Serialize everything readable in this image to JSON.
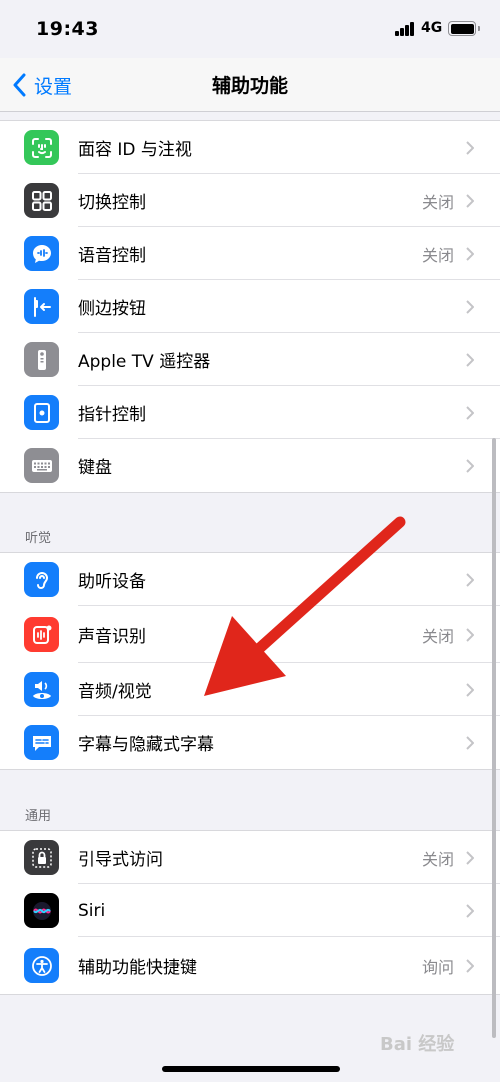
{
  "status_bar": {
    "time": "19:43",
    "network": "4G"
  },
  "nav": {
    "back_label": "设置",
    "title": "辅助功能"
  },
  "group_top": [
    {
      "name": "face-id",
      "label": "面容 ID 与注视",
      "value": "",
      "icon": "face-id-icon",
      "color": "#34c759"
    },
    {
      "name": "switch-control",
      "label": "切换控制",
      "value": "关闭",
      "icon": "switch-control-icon",
      "color": "#3a3a3c"
    },
    {
      "name": "voice-control",
      "label": "语音控制",
      "value": "关闭",
      "icon": "voice-control-icon",
      "color": "#147efb"
    },
    {
      "name": "side-button",
      "label": "侧边按钮",
      "value": "",
      "icon": "side-button-icon",
      "color": "#147efb"
    },
    {
      "name": "apple-tv-remote",
      "label": "Apple TV 遥控器",
      "value": "",
      "icon": "remote-icon",
      "color": "#8e8e93"
    },
    {
      "name": "pointer-control",
      "label": "指针控制",
      "value": "",
      "icon": "pointer-icon",
      "color": "#147efb"
    },
    {
      "name": "keyboard",
      "label": "键盘",
      "value": "",
      "icon": "keyboard-icon",
      "color": "#8e8e93"
    }
  ],
  "section_hearing": {
    "header": "听觉"
  },
  "group_hearing": [
    {
      "name": "hearing-devices",
      "label": "助听设备",
      "value": "",
      "icon": "ear-icon",
      "color": "#147efb"
    },
    {
      "name": "sound-recognition",
      "label": "声音识别",
      "value": "关闭",
      "icon": "sound-recognition-icon",
      "color": "#ff3b30"
    },
    {
      "name": "audio-visual",
      "label": "音频/视觉",
      "value": "",
      "icon": "audio-visual-icon",
      "color": "#147efb"
    },
    {
      "name": "subtitles-captioning",
      "label": "字幕与隐藏式字幕",
      "value": "",
      "icon": "captions-icon",
      "color": "#147efb"
    }
  ],
  "section_general": {
    "header": "通用"
  },
  "group_general": [
    {
      "name": "guided-access",
      "label": "引导式访问",
      "value": "关闭",
      "icon": "lock-icon",
      "color": "#3a3a3c"
    },
    {
      "name": "siri",
      "label": "Siri",
      "value": "",
      "icon": "siri-icon",
      "color": "#000000"
    },
    {
      "name": "accessibility-shortcut",
      "label": "辅助功能快捷键",
      "value": "询问",
      "icon": "accessibility-icon",
      "color": "#147efb"
    }
  ],
  "colors": {
    "accent": "#007aff",
    "annotation_arrow": "#e0261b"
  },
  "watermark": "Bai 经验"
}
